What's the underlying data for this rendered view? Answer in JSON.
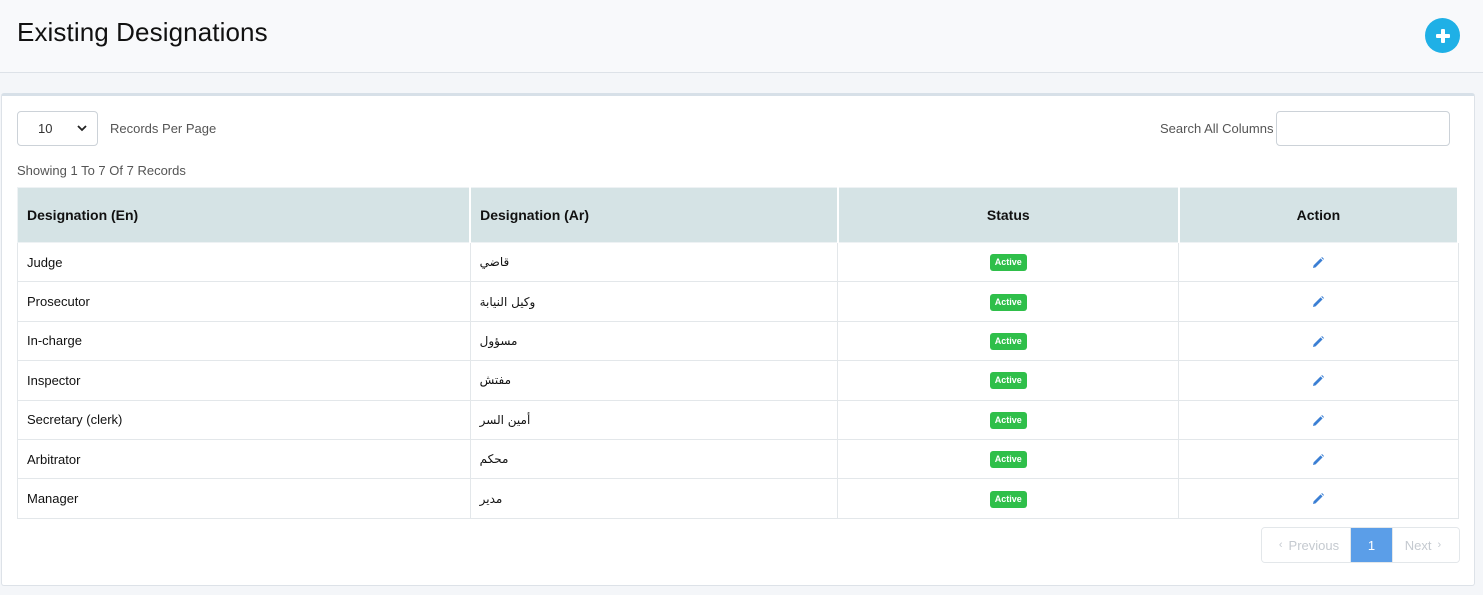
{
  "header": {
    "title": "Existing Designations",
    "add_icon": "plus-circle-icon"
  },
  "controls": {
    "page_length": "10",
    "page_length_label": "Records Per Page",
    "search_label": "Search All Columns",
    "search_value": "",
    "info": "Showing 1 To 7 Of 7 Records"
  },
  "table": {
    "columns": [
      "Designation (En)",
      "Designation (Ar)",
      "Status",
      "Action"
    ],
    "rows": [
      {
        "en": "Judge",
        "ar": "قاضي",
        "status": "Active"
      },
      {
        "en": "Prosecutor",
        "ar": "وكيل النيابة",
        "status": "Active"
      },
      {
        "en": "In-charge",
        "ar": "مسؤول",
        "status": "Active"
      },
      {
        "en": "Inspector",
        "ar": "مفتش",
        "status": "Active"
      },
      {
        "en": "Secretary (clerk)",
        "ar": "أمين السر",
        "status": "Active"
      },
      {
        "en": "Arbitrator",
        "ar": "محكم",
        "status": "Active"
      },
      {
        "en": "Manager",
        "ar": "مدير",
        "status": "Active"
      }
    ],
    "action_icon": "pencil-icon"
  },
  "pagination": {
    "previous": "Previous",
    "current": "1",
    "next": "Next"
  },
  "colors": {
    "accent": "#1fb0e6",
    "badge": "#2fbf4a",
    "header_bg": "#d5e3e5",
    "page_active": "#5b9ee8",
    "edit_icon": "#3b7fd4"
  }
}
